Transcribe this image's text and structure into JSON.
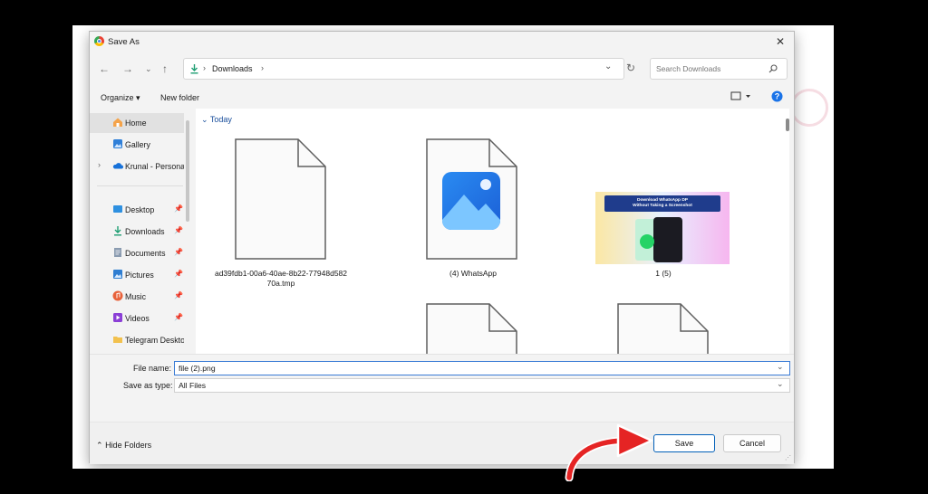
{
  "window": {
    "title": "Save As",
    "close_icon": "close-icon",
    "app_icon": "chrome-icon"
  },
  "nav": {
    "back_icon": "arrow-left-icon",
    "forward_icon": "arrow-right-icon",
    "recent_icon": "chevron-down-icon",
    "up_icon": "arrow-up-icon",
    "refresh_icon": "refresh-icon"
  },
  "address": {
    "segment": "Downloads",
    "sep": "›"
  },
  "search": {
    "placeholder": "Search Downloads"
  },
  "toolbar": {
    "organize": "Organize ▾",
    "new_folder": "New folder"
  },
  "sidebar": {
    "items": [
      {
        "label": "Home",
        "icon": "home-icon"
      },
      {
        "label": "Gallery",
        "icon": "gallery-icon"
      },
      {
        "label": "Krunal - Personal",
        "icon": "onedrive-icon"
      },
      {
        "label": "Desktop",
        "icon": "desktop-icon"
      },
      {
        "label": "Downloads",
        "icon": "download-icon"
      },
      {
        "label": "Documents",
        "icon": "documents-icon"
      },
      {
        "label": "Pictures",
        "icon": "pictures-icon"
      },
      {
        "label": "Music",
        "icon": "music-icon"
      },
      {
        "label": "Videos",
        "icon": "videos-icon"
      },
      {
        "label": "Telegram Desktop",
        "icon": "folder-icon"
      }
    ]
  },
  "content": {
    "group_label": "Today",
    "files": [
      {
        "name": "ad39fdb1-00a6-40ae-8b22-77948d582\n70a.tmp",
        "icon": "blank-file-icon"
      },
      {
        "name": "(4) WhatsApp",
        "icon": "photos-file-icon"
      },
      {
        "name": "1 (5)",
        "icon": "image-thumbnail"
      }
    ],
    "thumb_text": "Download WhatsApp DP\nWithout Taking a Screenshot"
  },
  "form": {
    "file_name_label": "File name:",
    "file_name_value": "file (2).png",
    "save_type_label": "Save as type:",
    "save_type_value": "All Files"
  },
  "footer": {
    "hide_folders": "Hide Folders",
    "save": "Save",
    "cancel": "Cancel"
  },
  "colors": {
    "accent": "#005fb8",
    "arrow": "#e52424",
    "download_green": "#1f9e73"
  }
}
